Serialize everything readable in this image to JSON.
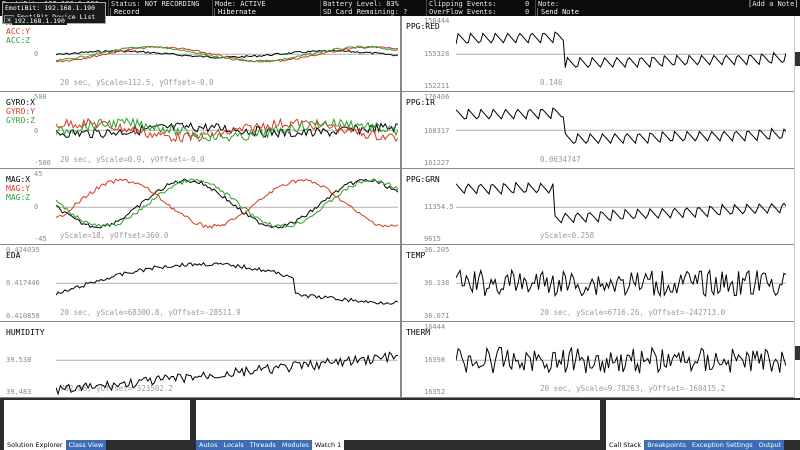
{
  "topbar": {
    "device_ip": "EmotiBit: 192.168.1.190",
    "device_list_label": "EmotiBit Device List",
    "device_list_ip": "192.168.1.190",
    "status": "Status: NOT RECORDING",
    "record_label": "Record",
    "mode": "Mode: ACTIVE",
    "hibernate_label": "Hibernate",
    "battery": "Battery Level: 83%",
    "sd_card": "SD Card Remaining: ?",
    "clipping": "Clipping Events:",
    "clipping_count": "0",
    "overflow": "OverFlow Events:",
    "overflow_count": "0",
    "note": "Note:",
    "add_note_label": "[Add a Note]",
    "send_note_label": "Send Note"
  },
  "panels_left": [
    {
      "labels": [
        "ACC:X",
        "ACC:Y",
        "ACC:Z"
      ],
      "colors": [
        "#000000",
        "#d9381e",
        "#2e9e2e"
      ],
      "y_top": "",
      "y_mid": "0",
      "y_bot": "",
      "status": "20 sec, yScale=112.5, yOffset=-0.0"
    },
    {
      "labels": [
        "GYRO:X",
        "GYRO:Y",
        "GYRO:Z"
      ],
      "colors": [
        "#000000",
        "#d9381e",
        "#2e9e2e"
      ],
      "y_top": "500",
      "y_mid": "0",
      "y_bot": "-500",
      "status": "20 sec, yScale=0.9, yOffset=-0.0"
    },
    {
      "labels": [
        "MAG:X",
        "MAG:Y",
        "MAG:Z"
      ],
      "colors": [
        "#000000",
        "#d9381e",
        "#2e9e2e"
      ],
      "y_top": "45",
      "y_mid": "0",
      "y_bot": "-45",
      "status": "yScale=18, yOffset=360.0"
    },
    {
      "labels": [
        "EDA"
      ],
      "colors": [
        "#000000"
      ],
      "y_top": "0.424035",
      "y_mid": "0.417446",
      "y_bot": "0.410858",
      "status": "20 sec, yScale=68300.8, yOffset=-28511.9"
    },
    {
      "labels": [
        "HUMIDITY"
      ],
      "colors": [
        "#000000"
      ],
      "y_top": "",
      "y_mid": "39.538",
      "y_bot": "39.483",
      "status": "782.06, yOffset=-323502.2"
    }
  ],
  "panels_right": [
    {
      "labels": [
        "PPG:RED"
      ],
      "colors": [
        "#000000"
      ],
      "y_top": "158444",
      "y_mid": "155328",
      "y_bot": "152211",
      "status": "0.146"
    },
    {
      "labels": [
        "PPG:IR"
      ],
      "colors": [
        "#000000"
      ],
      "y_top": "176406",
      "y_mid": "168317",
      "y_bot": "161227",
      "status": "0.0634747"
    },
    {
      "labels": [
        "PPG:GRN"
      ],
      "colors": [
        "#000000"
      ],
      "y_top": "",
      "y_mid": "11354.5",
      "y_bot": "9615",
      "status": "yScale=0.258"
    },
    {
      "labels": [
        "TEMP"
      ],
      "colors": [
        "#000000"
      ],
      "y_top": "36.205",
      "y_mid": "36.138",
      "y_bot": "36.071",
      "status": "20 sec, yScale=6716.26, yOffset=-242713.0"
    },
    {
      "labels": [
        "THERM"
      ],
      "colors": [
        "#000000"
      ],
      "y_top": "16444",
      "y_mid": "16398",
      "y_bot": "16352",
      "status": "20 sec, yScale=9.78263, yOffset=-160415.2"
    }
  ],
  "bottom": {
    "left_tabs": [
      "Solution Explorer",
      "Class View"
    ],
    "mid_tabs": [
      "Autos",
      "Locals",
      "Threads",
      "Modules",
      "Watch 1"
    ],
    "right_tabs": [
      "Call Stack",
      "Breakpoints",
      "Exception Settings",
      "Output"
    ]
  }
}
